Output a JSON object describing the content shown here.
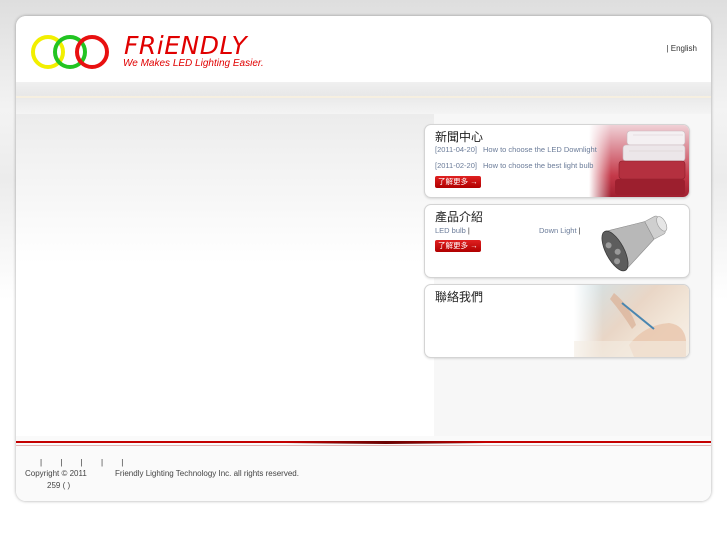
{
  "header": {
    "logo_word": "FRiENDLY",
    "logo_tagline": "We Makes LED Lighting Easier.",
    "language_separator": "|",
    "language_link": "English"
  },
  "colors": {
    "accent_red": "#e00000",
    "button_red": "#c00000",
    "footer_rule": "#c40000",
    "link_blue_gray": "#6b7c99"
  },
  "news": {
    "title": "新聞中心",
    "items": [
      {
        "date": "[2011-04-20]",
        "title": "How to choose the LED Downlight"
      },
      {
        "date": "[2011-02-20]",
        "title": "How to choose the best light bulb"
      }
    ],
    "more_label": "了解更多 →"
  },
  "products": {
    "title": "產品介紹",
    "items": [
      {
        "label": "LED bulb",
        "sep": "|"
      },
      {
        "label": "Down Light",
        "sep": "|"
      }
    ],
    "more_label": "了解更多 →"
  },
  "contact": {
    "title": "聯絡我們"
  },
  "footer": {
    "nav_separators": [
      "|",
      "|",
      "|",
      "|",
      "|"
    ],
    "copyright": "Copyright © 2011",
    "company": "Friendly Lighting Technology Inc. all rights reserved.",
    "address": "259 (            )"
  },
  "icons": [
    "logo-rings-icon",
    "binders-image",
    "led-bulb-image",
    "writing-hands-image",
    "arrow-right-icon"
  ]
}
